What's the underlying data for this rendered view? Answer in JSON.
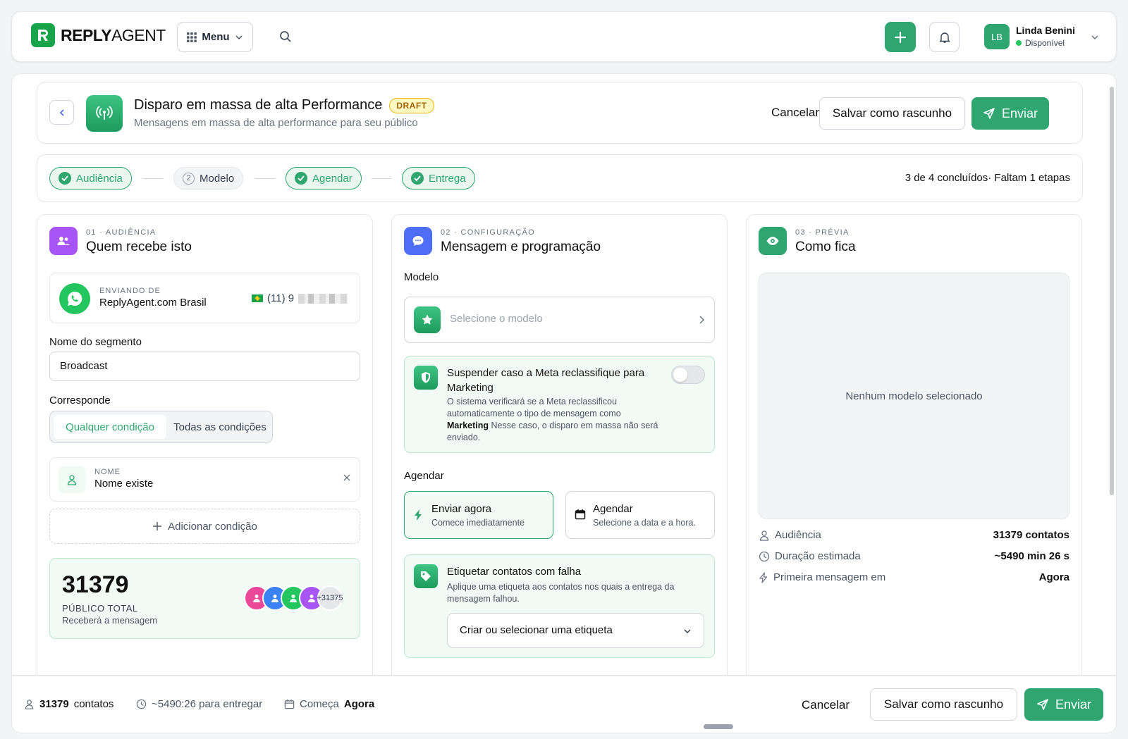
{
  "brand": {
    "name_bold": "REPLY",
    "name_light": "AGENT"
  },
  "topbar": {
    "menu_label": "Menu",
    "user_initials": "LB",
    "user_name": "Linda Benini",
    "user_status": "Disponível"
  },
  "header": {
    "title": "Disparo em massa de alta Performance",
    "badge": "DRAFT",
    "subtitle": "Mensagens em massa de alta performance para seu público",
    "cancel": "Cancelar",
    "save_draft": "Salvar como rascunho",
    "send": "Enviar"
  },
  "steps": {
    "items": [
      {
        "label": "Audiência",
        "state": "done"
      },
      {
        "label": "Modelo",
        "state": "todo",
        "number": "2"
      },
      {
        "label": "Agendar",
        "state": "done"
      },
      {
        "label": "Entrega",
        "state": "done"
      }
    ],
    "progress": "3 de 4 concluídos· Faltam 1 etapas"
  },
  "audience": {
    "kicker": "01 · AUDIÊNCIA",
    "title": "Quem recebe isto",
    "sender_kicker": "ENVIANDO DE",
    "sender_name": "ReplyAgent.com Brasil",
    "sender_phone": "(11) 9",
    "segment_label": "Nome do segmento",
    "segment_value": "Broadcast",
    "match_label": "Corresponde",
    "match_any": "Qualquer condição",
    "match_all": "Todas as condições",
    "condition_kicker": "NOME",
    "condition_value": "Nome existe",
    "add_condition": "Adicionar condição",
    "total": "31379",
    "total_label": "PÚBLICO TOTAL",
    "total_sub": "Receberá a mensagem",
    "more_avatars": "+31375"
  },
  "config": {
    "kicker": "02 · CONFIGURAÇÃO",
    "title": "Mensagem e programação",
    "model_label": "Modelo",
    "model_placeholder": "Selecione o modelo",
    "suspend_title": "Suspender caso a Meta reclassifique para Marketing",
    "suspend_desc_1": "O sistema verificará se a Meta reclassificou automaticamente o tipo de mensagem como",
    "suspend_desc_bold": "Marketing",
    "suspend_desc_2": "Nesse caso, o disparo em massa não será enviado.",
    "suspend_enabled": false,
    "schedule_label": "Agendar",
    "send_now_title": "Enviar agora",
    "send_now_sub": "Comece imediatamente",
    "schedule_title": "Agendar",
    "schedule_sub": "Selecione a data e a hora.",
    "tag_title": "Etiquetar contatos com falha",
    "tag_desc": "Aplique uma etiqueta aos contatos nos quais a entrega da mensagem falhou.",
    "tag_placeholder": "Criar ou selecionar uma etiqueta"
  },
  "preview": {
    "kicker": "03 · PRÉVIA",
    "title": "Como fica",
    "empty": "Nenhum modelo selecionado",
    "stats": [
      {
        "label": "Audiência",
        "value": "31379 contatos",
        "icon": "user-icon"
      },
      {
        "label": "Duração estimada",
        "value": "~5490 min 26 s",
        "icon": "clock-icon"
      },
      {
        "label": "Primeira mensagem em",
        "value": "Agora",
        "icon": "bolt-icon"
      }
    ]
  },
  "footer": {
    "contacts_count": "31379",
    "contacts_label": "contatos",
    "eta": "~5490:26 para entregar",
    "starts_label": "Começa",
    "starts_value": "Agora",
    "cancel": "Cancelar",
    "save_draft": "Salvar como rascunho",
    "send": "Enviar"
  },
  "colors": {
    "accent": "#2fa56f",
    "draft": "#eab308",
    "purple": "#a855f7",
    "blue": "#4f6ef7"
  }
}
